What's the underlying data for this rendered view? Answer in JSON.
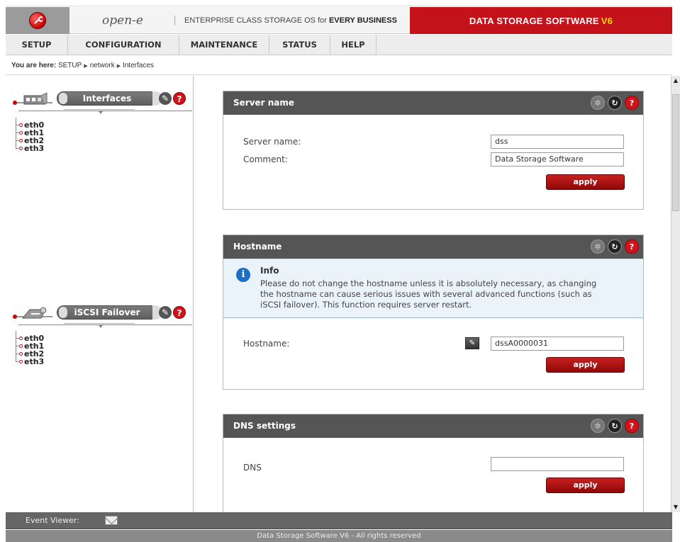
{
  "header": {
    "brand": "open-e",
    "tagline_prefix": "ENTERPRISE CLASS STORAGE OS for ",
    "tagline_bold": "EVERY BUSINESS",
    "product_title": "DATA STORAGE SOFTWARE",
    "product_version": "V6",
    "logo_icon": "wrench-logo-icon"
  },
  "menu": {
    "items": [
      {
        "label": "SETUP"
      },
      {
        "label": "CONFIGURATION"
      },
      {
        "label": "MAINTENANCE"
      },
      {
        "label": "STATUS"
      },
      {
        "label": "HELP"
      }
    ]
  },
  "breadcrumb": {
    "prefix": "You are here:",
    "items": [
      "SETUP",
      "network",
      "Interfaces"
    ]
  },
  "left": {
    "interfaces": {
      "title": "Interfaces",
      "items": [
        "eth0",
        "eth1",
        "eth2",
        "eth3"
      ]
    },
    "failover": {
      "title": "iSCSI Failover",
      "items": [
        "eth0",
        "eth1",
        "eth2",
        "eth3"
      ]
    }
  },
  "panels": {
    "server_name": {
      "title": "Server name",
      "server_name_label": "Server name:",
      "server_name_value": "dss",
      "comment_label": "Comment:",
      "comment_value": "Data Storage Software",
      "apply_label": "apply"
    },
    "hostname": {
      "title": "Hostname",
      "info_title": "Info",
      "info_text": "Please do not change the hostname unless it is absolutely necessary, as changing the hostname can cause serious issues with several advanced functions (such as iSCSI failover). This function requires server restart.",
      "hostname_label": "Hostname:",
      "hostname_value": "dssA0000031",
      "apply_label": "apply"
    },
    "dns": {
      "title": "DNS settings",
      "dns_label": "DNS",
      "dns_value": "",
      "apply_label": "apply"
    }
  },
  "status": {
    "event_viewer_label": "Event Viewer:",
    "footer_text": "Data Storage Software V6 - All rights reserved"
  },
  "colors": {
    "accent_red": "#c4121a",
    "version_yellow": "#ffd800",
    "panel_header": "#555555",
    "info_blue": "#1b6fc6"
  }
}
